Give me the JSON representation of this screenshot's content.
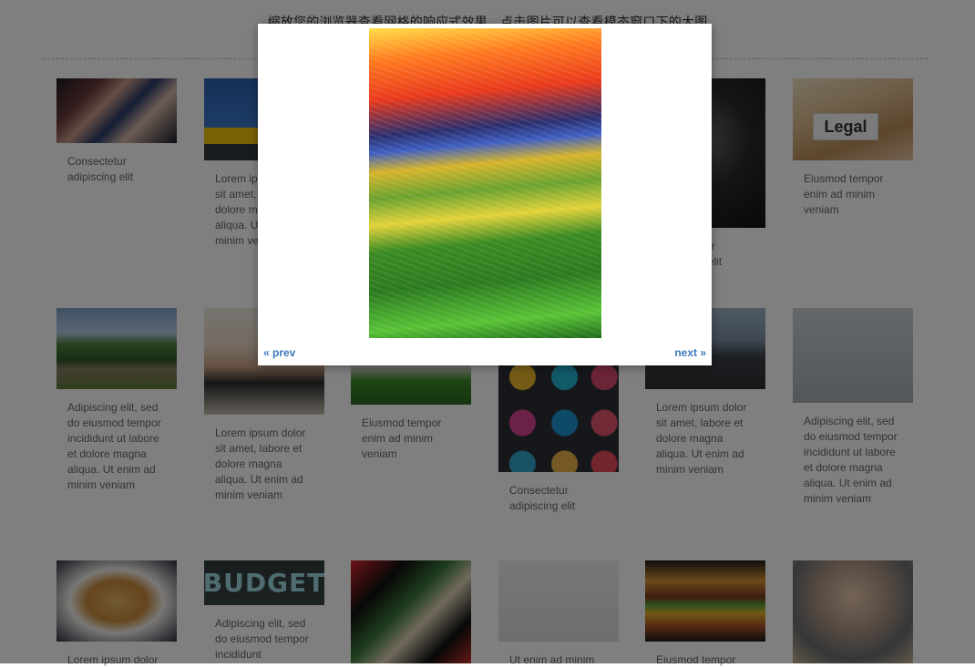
{
  "header": {
    "instruction": "缩放您的浏览器查看网格的响应式效果，点击图片可以查看模态窗口下的大图"
  },
  "gallery": {
    "items": [
      {
        "image": "concert-crowd-photo",
        "caption": "Consectetur adipiscing elit"
      },
      {
        "image": "road-sign-photo",
        "caption": "Lorem ipsum dolor sit amet, labore et dolore magna aliqua. Ut enim ad minim veniam"
      },
      {
        "image": "dark-object-photo",
        "caption": "Consectetur adipiscing elit"
      },
      {
        "image": "legal-folder-photo",
        "caption": "Eiusmod tempor enim ad minim veniam",
        "tag": "Legal"
      },
      {
        "image": "stone-bridge-photo",
        "caption": "Adipiscing elit, sed do eiusmod tempor incididunt ut labore et dolore magna aliqua. Ut enim ad minim veniam"
      },
      {
        "image": "kid-camera-photo",
        "caption": "Lorem ipsum dolor sit amet, labore et dolore magna aliqua. Ut enim ad minim veniam"
      },
      {
        "image": "grass-photo",
        "caption": "Eiusmod tempor enim ad minim veniam"
      },
      {
        "image": "spray-cans-photo",
        "caption": "Consectetur adipiscing elit"
      },
      {
        "image": "arch-bridge-photo",
        "caption": "Lorem ipsum dolor sit amet, labore et dolore magna aliqua. Ut enim ad minim veniam"
      },
      {
        "image": "book-stack-photo",
        "caption": "Adipiscing elit, sed do eiusmod tempor incididunt ut labore et dolore magna aliqua. Ut enim ad minim veniam"
      },
      {
        "image": "pasta-photo",
        "caption": "Lorem ipsum dolor"
      },
      {
        "image": "budget-chalkboard-photo",
        "caption": "Adipiscing elit, sed do eiusmod tempor incididunt",
        "tag": "BUDGET"
      },
      {
        "image": "abstract-art-photo",
        "caption": ""
      },
      {
        "image": "umbrella-man-photo",
        "caption": "Ut enim ad minim"
      },
      {
        "image": "burger-photo",
        "caption": "Eiusmod tempor"
      },
      {
        "image": "student-books-photo",
        "caption": ""
      }
    ]
  },
  "lightbox": {
    "image": "colorful-abstract-lines-photo",
    "prev_label": "« prev",
    "next_label": "next »"
  },
  "colors": {
    "link": "#3b79b8",
    "overlay": "rgba(0,0,0,0.5)"
  }
}
